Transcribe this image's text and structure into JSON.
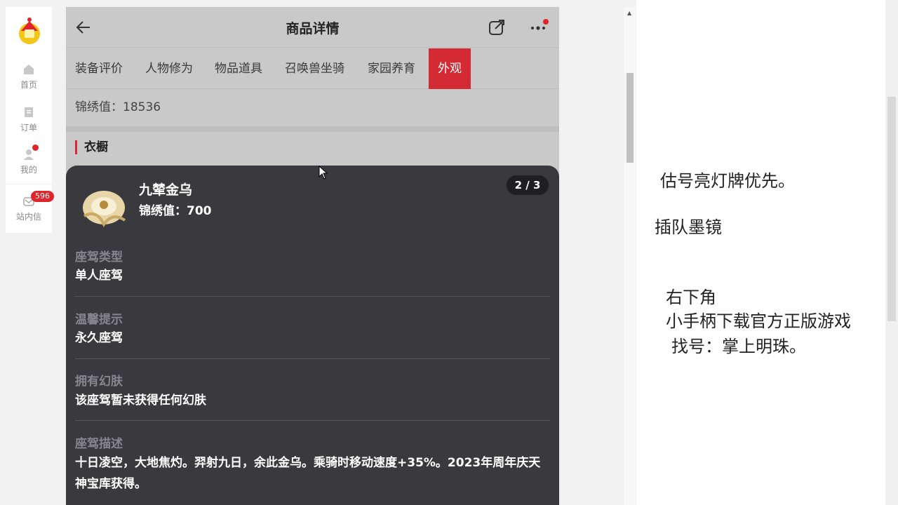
{
  "sidebar": {
    "items": [
      {
        "label": "首页",
        "icon": "home-icon"
      },
      {
        "label": "订单",
        "icon": "order-icon"
      },
      {
        "label": "我的",
        "icon": "user-icon"
      },
      {
        "label": "站内信",
        "icon": "mail-icon",
        "badge": "596"
      }
    ]
  },
  "header": {
    "title": "商品详情"
  },
  "tabs": [
    "装备评价",
    "人物修为",
    "物品道具",
    "召唤兽坐骑",
    "家园养育",
    "外观"
  ],
  "active_tab": "外观",
  "durability_text": "锦绣值：18536",
  "section_title": "衣橱",
  "popup": {
    "name": "九辇金乌",
    "durability": "锦绣值：700",
    "pager": "2 / 3",
    "fields": [
      {
        "label": "座驾类型",
        "value": "单人座驾"
      },
      {
        "label": "温馨提示",
        "value": "永久座驾"
      },
      {
        "label": "拥有幻肤",
        "value": "该座驾暂未获得任何幻肤"
      },
      {
        "label": "座驾描述",
        "value": "十日凌空，大地焦灼。羿射九日，余此金乌。乘骑时移动速度+35%。2023年周年庆天神宝库获得。"
      }
    ]
  },
  "notes": {
    "line1": "估号亮灯牌优先。",
    "line2": "插队墨镜",
    "line3": "右下角",
    "line4": "小手柄下载官方正版游戏",
    "line5": "找号：掌上明珠。"
  },
  "colors": {
    "accent": "#d42a33",
    "card_bg": "#3a3a3e"
  }
}
